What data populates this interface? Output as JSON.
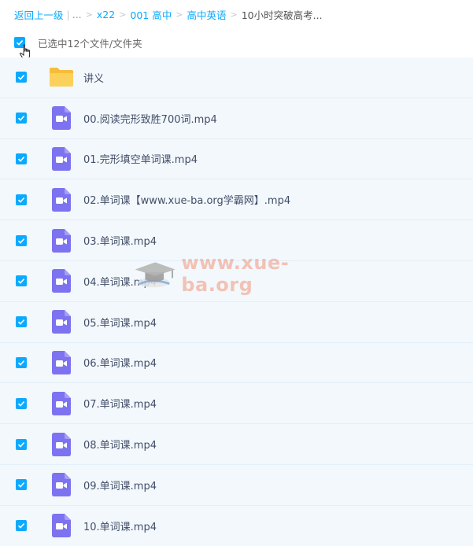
{
  "breadcrumb": {
    "back": "返回上一级",
    "ellipsis": "...",
    "items": [
      "x22",
      "001 高中",
      "高中英语"
    ],
    "current": "10小时突破高考..."
  },
  "selection": {
    "label": "已选中12个文件/文件夹"
  },
  "files": [
    {
      "name": "讲义",
      "type": "folder"
    },
    {
      "name": "00.阅读完形致胜700词.mp4",
      "type": "video"
    },
    {
      "name": "01.完形填空单词课.mp4",
      "type": "video"
    },
    {
      "name": "02.单词课【www.xue-ba.org学霸网】.mp4",
      "type": "video"
    },
    {
      "name": "03.单词课.mp4",
      "type": "video"
    },
    {
      "name": "04.单词课.mp4",
      "type": "video"
    },
    {
      "name": "05.单词课.mp4",
      "type": "video"
    },
    {
      "name": "06.单词课.mp4",
      "type": "video"
    },
    {
      "name": "07.单词课.mp4",
      "type": "video"
    },
    {
      "name": "08.单词课.mp4",
      "type": "video"
    },
    {
      "name": "09.单词课.mp4",
      "type": "video"
    },
    {
      "name": "10.单词课.mp4",
      "type": "video"
    }
  ],
  "watermark": {
    "text": "www.xue-ba.org"
  },
  "colors": {
    "accent": "#09aaff",
    "row_bg": "#f3f8fd",
    "folder": "#f8c94a",
    "video_icon": "#7d73f0"
  }
}
